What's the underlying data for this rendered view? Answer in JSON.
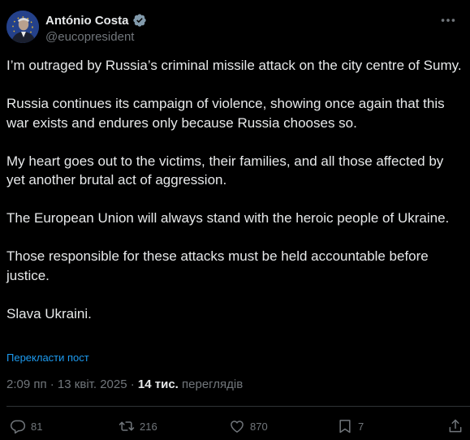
{
  "author": {
    "name": "António Costa",
    "handle": "@eucopresident"
  },
  "post": {
    "paragraphs": [
      "I’m outraged by Russia’s criminal missile attack on the city centre of Sumy.",
      "Russia continues its campaign of violence, showing once again that this war exists and endures only because Russia chooses so.",
      "My heart goes out to the victims, their families, and all those affected by yet another brutal act of aggression.",
      "The European Union will always stand with the heroic people of Ukraine.",
      "Those responsible for these attacks must be held accountable before justice.",
      "Slava Ukraini."
    ],
    "translate_label": "Перекласти пост",
    "timestamp": "2:09 пп · 13 квіт. 2025 ·",
    "views_count": "14 тис.",
    "views_label": "переглядів"
  },
  "actions": {
    "reply_count": "81",
    "repost_count": "216",
    "like_count": "870",
    "bookmark_count": "7"
  },
  "icons": {
    "verified": "verified-badge-icon",
    "more": "more-options-icon",
    "reply": "reply-icon",
    "repost": "repost-icon",
    "like": "heart-icon",
    "bookmark": "bookmark-icon",
    "share": "share-icon"
  },
  "colors": {
    "background": "#000000",
    "text": "#e7e9ea",
    "secondary": "#71767b",
    "link": "#1d9bf0",
    "divider": "#2f3336"
  }
}
